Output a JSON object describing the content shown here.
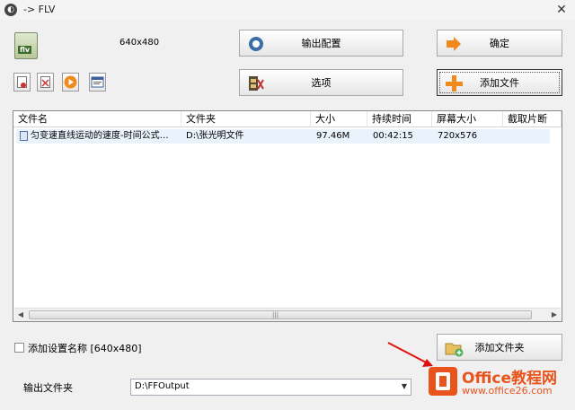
{
  "window": {
    "title": "-> FLV",
    "close_glyph": "✕"
  },
  "profile": {
    "icon_text": "flv",
    "resolution": "640x480"
  },
  "buttons": {
    "output_config": "输出配置",
    "options": "选项",
    "ok": "确定",
    "add_file": "添加文件",
    "add_folder": "添加文件夹"
  },
  "small_toolbar": [
    {
      "name": "remove-icon"
    },
    {
      "name": "clear-list-icon"
    },
    {
      "name": "play-icon"
    },
    {
      "name": "file-info-icon"
    }
  ],
  "file_list": {
    "columns": [
      "文件名",
      "文件夹",
      "大小",
      "持续时间",
      "屏幕大小",
      "截取片断"
    ],
    "rows": [
      {
        "name": "匀变速直线运动的速度-时间公式…",
        "folder": "D:\\张光明文件",
        "size": "97.46M",
        "duration": "00:42:15",
        "screen": "720x576",
        "clip": ""
      }
    ],
    "scroll_thumb_glyph": "|||"
  },
  "settings": {
    "checkbox_label": "添加设置名称  [640x480]",
    "checked": false
  },
  "output": {
    "label": "输出文件夹",
    "value": "D:\\FFOutput",
    "arrow_glyph": "▼"
  },
  "watermark": {
    "brand": "Office教程网",
    "url": "www.office26.com"
  },
  "colors": {
    "accent_orange": "#e8541c",
    "arrow_red": "#e01010",
    "row_highlight": "#eaf3fb"
  }
}
